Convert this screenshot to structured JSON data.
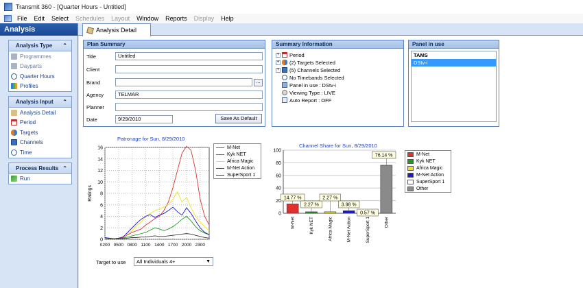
{
  "window": {
    "title": "Transmit 360 - [Quarter Hours - Untitled]"
  },
  "menu": [
    {
      "label": "File",
      "enabled": true
    },
    {
      "label": "Edit",
      "enabled": true
    },
    {
      "label": "Select",
      "enabled": true
    },
    {
      "label": "Schedules",
      "enabled": false
    },
    {
      "label": "Layout",
      "enabled": false
    },
    {
      "label": "Window",
      "enabled": true
    },
    {
      "label": "Reports",
      "enabled": true
    },
    {
      "label": "Display",
      "enabled": false
    },
    {
      "label": "Help",
      "enabled": true
    }
  ],
  "sidebar": {
    "title": "Analysis",
    "panels": [
      {
        "title": "Analysis Type",
        "items": [
          {
            "label": "Programmes",
            "icon": "grid-icon",
            "enabled": false
          },
          {
            "label": "Dayparts",
            "icon": "grid-icon",
            "enabled": false
          },
          {
            "label": "Quarter Hours",
            "icon": "clock-icon",
            "enabled": true
          },
          {
            "label": "Profiles",
            "icon": "bar-chart-icon",
            "enabled": true
          }
        ]
      },
      {
        "title": "Analysis Input",
        "items": [
          {
            "label": "Analysis Detail",
            "icon": "pencil-icon",
            "enabled": true
          },
          {
            "label": "Period",
            "icon": "calendar-icon",
            "enabled": true
          },
          {
            "label": "Targets",
            "icon": "people-icon",
            "enabled": true
          },
          {
            "label": "Channels",
            "icon": "monitor-icon",
            "enabled": true
          },
          {
            "label": "Time",
            "icon": "clock-icon",
            "enabled": true
          }
        ]
      },
      {
        "title": "Process Results",
        "items": [
          {
            "label": "Run",
            "icon": "run-icon",
            "enabled": true
          }
        ]
      }
    ]
  },
  "tabs": [
    {
      "label": "Analysis Detail"
    }
  ],
  "plan_summary": {
    "title": "Plan Summary",
    "fields": [
      {
        "label": "Title",
        "value": "Untitled"
      },
      {
        "label": "Client",
        "value": ""
      },
      {
        "label": "Brand",
        "value": ""
      },
      {
        "label": "Agency",
        "value": "TELMAR"
      },
      {
        "label": "Planner",
        "value": ""
      },
      {
        "label": "Date",
        "value": "9/29/2010"
      }
    ],
    "browse_label": "...",
    "save_default_label": "Save As Default"
  },
  "summary_info": {
    "title": "Summary Information",
    "rows": [
      {
        "label": "Period",
        "icon": "calendar-icon",
        "expandable": true
      },
      {
        "label": "(2) Targets Selected",
        "icon": "people-icon",
        "expandable": true
      },
      {
        "label": "(5) Channels Selected",
        "icon": "monitor-icon",
        "expandable": true
      },
      {
        "label": "No Timebands Selected",
        "icon": "clock-icon",
        "expandable": false
      },
      {
        "label": "Panel in use : DStv-i",
        "icon": "panel-icon",
        "expandable": false
      },
      {
        "label": "Viewing Type : LIVE",
        "icon": "eye-icon",
        "expandable": false
      },
      {
        "label": "Auto Report : OFF",
        "icon": "report-icon",
        "expandable": false
      }
    ]
  },
  "panel_in_use": {
    "title": "Panel in use",
    "items": [
      {
        "label": "TAMS",
        "selected": false
      },
      {
        "label": "DStv-i",
        "selected": true
      }
    ]
  },
  "colors": {
    "M-Net": "#e03030",
    "Kyk NET": "#1f9d1f",
    "Africa Magic": "#f0e020",
    "M-Net Action": "#1c1cc8",
    "SuperSport 1": "#ffffff",
    "Other": "#8a8a8a"
  },
  "target": {
    "label": "Target to use",
    "value": "All Individuals 4+"
  },
  "chart_data": [
    {
      "type": "line",
      "title": "Patronage for Sun, 8/29/2010",
      "ylabel": "Ratings",
      "xlabel": "",
      "ylim": [
        0,
        16
      ],
      "yticks": [
        0,
        2,
        4,
        6,
        8,
        10,
        12,
        14,
        16
      ],
      "xlim": [
        2,
        25
      ],
      "xticks": [
        2,
        5,
        8,
        11,
        14,
        17,
        20,
        23
      ],
      "xtick_labels": [
        "0200",
        "0500",
        "0800",
        "1100",
        "1400",
        "1700",
        "2000",
        "2300"
      ],
      "grid": true,
      "legend": "right",
      "series": [
        {
          "name": "M-Net",
          "x": [
            2,
            3,
            4,
            5,
            6,
            7,
            8,
            9,
            10,
            11,
            12,
            13,
            14,
            15,
            16,
            17,
            18,
            19,
            20,
            21,
            22,
            23,
            24,
            25
          ],
          "values": [
            0.2,
            0.1,
            0.1,
            0.1,
            0.3,
            0.8,
            1.2,
            1.5,
            1.8,
            2.5,
            3,
            3.6,
            4,
            5,
            6.5,
            9,
            12,
            15,
            16.2,
            15.5,
            12,
            7,
            4,
            2.5
          ]
        },
        {
          "name": "Kyk NET",
          "x": [
            2,
            3,
            4,
            5,
            6,
            7,
            8,
            9,
            10,
            11,
            12,
            13,
            14,
            15,
            16,
            17,
            18,
            19,
            20,
            21,
            22,
            23,
            24,
            25
          ],
          "values": [
            0.1,
            0.1,
            0.1,
            0.1,
            0.2,
            0.4,
            0.6,
            0.8,
            1,
            1.2,
            1.6,
            2,
            1.8,
            1.5,
            1.8,
            2.2,
            2.8,
            3.5,
            4,
            3.2,
            2.2,
            1.5,
            1.1,
            0.8
          ]
        },
        {
          "name": "Africa Magic",
          "x": [
            2,
            3,
            4,
            5,
            6,
            7,
            8,
            9,
            10,
            11,
            12,
            13,
            14,
            15,
            16,
            17,
            18,
            19,
            20,
            21,
            22,
            23,
            24,
            25
          ],
          "values": [
            0.2,
            0.1,
            0.1,
            0.2,
            0.5,
            1,
            1.5,
            2.4,
            3,
            4,
            4.5,
            5,
            5.3,
            5.6,
            6,
            7,
            8.3,
            6.5,
            7.3,
            5.5,
            4,
            3,
            2.2,
            1.5
          ]
        },
        {
          "name": "M-Net Action",
          "x": [
            2,
            3,
            4,
            5,
            6,
            7,
            8,
            9,
            10,
            11,
            12,
            13,
            14,
            15,
            16,
            17,
            18,
            19,
            20,
            21,
            22,
            23,
            24,
            25
          ],
          "values": [
            0.3,
            0.2,
            0.1,
            0.2,
            0.4,
            1.2,
            2,
            2.8,
            3.5,
            4,
            4.3,
            3.8,
            4.2,
            4.5,
            5,
            5.6,
            4.8,
            4.2,
            5.5,
            4.5,
            3.2,
            2,
            1.2,
            0.8
          ]
        },
        {
          "name": "SuperSport 1",
          "x": [
            2,
            3,
            4,
            5,
            6,
            7,
            8,
            9,
            10,
            11,
            12,
            13,
            14,
            15,
            16,
            17,
            18,
            19,
            20,
            21,
            22,
            23,
            24,
            25
          ],
          "values": [
            0.1,
            0.1,
            0.1,
            0.1,
            0.1,
            0.2,
            0.3,
            0.3,
            0.4,
            0.4,
            0.5,
            0.6,
            0.5,
            0.5,
            0.6,
            0.7,
            0.8,
            0.9,
            1,
            0.9,
            0.7,
            0.5,
            0.3,
            0.2
          ]
        }
      ]
    },
    {
      "type": "bar",
      "title": "Channel Share for Sun, 8/29/2010",
      "ylim": [
        0,
        100
      ],
      "yticks": [
        0,
        20,
        40,
        60,
        80,
        100
      ],
      "categories": [
        "M-Net",
        "Kyk NET",
        "Africa Magic",
        "M-Net Action",
        "SuperSport 1",
        "Other"
      ],
      "values": [
        14.77,
        2.27,
        2.27,
        3.98,
        0.57,
        76.14
      ],
      "data_labels": [
        "14.77 %",
        "2.27 %",
        "2.27 %",
        "3.98 %",
        "0.57 %",
        "76.14 %"
      ],
      "legend": "right",
      "legend_entries": [
        "M-Net",
        "Kyk NET",
        "Africa Magic",
        "M-Net Action",
        "SuperSport 1",
        "Other"
      ]
    }
  ]
}
